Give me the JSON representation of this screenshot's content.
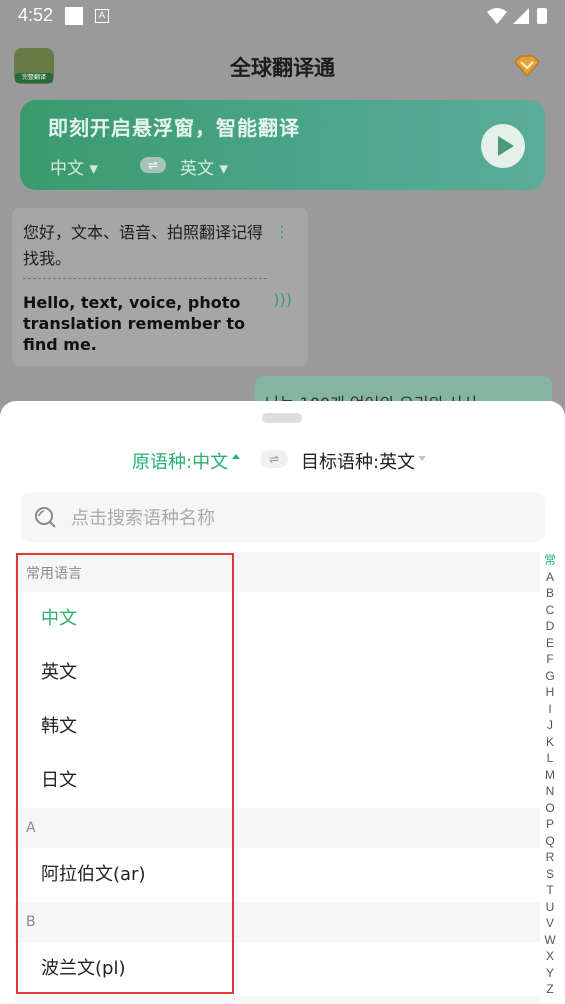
{
  "status_bar": {
    "time": "4:52"
  },
  "app_bar": {
    "title": "全球翻译通",
    "logo_label": "完整翻译"
  },
  "banner": {
    "headline": "即刻开启悬浮窗，智能翻译",
    "source_lang": "中文 ▾",
    "swap_icon": "⇌",
    "target_lang": "英文 ▾"
  },
  "chat": {
    "source_text": "您好，文本、语音、拍照翻译记得找我。",
    "translation": "Hello, text, voice, photo translation remember to find me.",
    "second_bubble": "나는 100개 언어의 요리의 사사"
  },
  "picker": {
    "source_label": "原语种:中文",
    "target_label": "目标语种:英文",
    "swap_icon": "⇌",
    "search_placeholder": "点击搜索语种名称",
    "common_header": "常用语言",
    "common": [
      "中文",
      "英文",
      "韩文",
      "日文"
    ],
    "selected": "中文",
    "sections": [
      {
        "letter": "A",
        "items": [
          "阿拉伯文(ar)"
        ]
      },
      {
        "letter": "B",
        "items": [
          "波兰文(pl)"
        ]
      }
    ],
    "index": [
      "常",
      "A",
      "B",
      "C",
      "D",
      "E",
      "F",
      "G",
      "H",
      "I",
      "J",
      "K",
      "L",
      "M",
      "N",
      "O",
      "P",
      "Q",
      "R",
      "S",
      "T",
      "U",
      "V",
      "W",
      "X",
      "Y",
      "Z"
    ]
  },
  "colors": {
    "accent": "#27b06f",
    "highlight_box": "#d93b3b"
  }
}
